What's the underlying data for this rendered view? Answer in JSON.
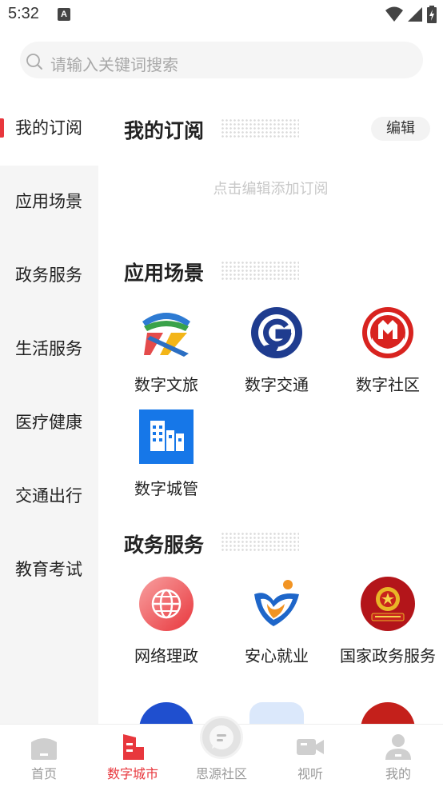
{
  "status_bar": {
    "time": "5:32",
    "notification_badge": "A"
  },
  "search": {
    "placeholder": "请输入关键词搜索"
  },
  "sidebar": {
    "items": [
      {
        "label": "我的订阅",
        "active": true
      },
      {
        "label": "应用场景"
      },
      {
        "label": "政务服务"
      },
      {
        "label": "生活服务"
      },
      {
        "label": "医疗健康"
      },
      {
        "label": "交通出行"
      },
      {
        "label": "教育考试"
      }
    ]
  },
  "subscriptions": {
    "title": "我的订阅",
    "edit_label": "编辑",
    "empty_hint": "点击编辑添加订阅"
  },
  "scenes": {
    "title": "应用场景",
    "apps": [
      {
        "name": "数字文旅",
        "icon": "culture-tourism-icon"
      },
      {
        "name": "数字交通",
        "icon": "transport-icon"
      },
      {
        "name": "数字社区",
        "icon": "community-icon"
      },
      {
        "name": "数字城管",
        "icon": "city-management-icon"
      }
    ]
  },
  "gov_services": {
    "title": "政务服务",
    "apps": [
      {
        "name": "网络理政",
        "icon": "globe-icon"
      },
      {
        "name": "安心就业",
        "icon": "employment-icon"
      },
      {
        "name": "国家政务服务",
        "icon": "national-emblem-icon"
      }
    ]
  },
  "bottom_nav": {
    "items": [
      {
        "label": "首页",
        "icon": "home-icon"
      },
      {
        "label": "数字城市",
        "icon": "city-icon",
        "active": true
      },
      {
        "label": "思源社区",
        "icon": "chat-icon"
      },
      {
        "label": "视听",
        "icon": "video-icon"
      },
      {
        "label": "我的",
        "icon": "person-icon"
      }
    ]
  },
  "colors": {
    "accent": "#e8373d",
    "sidebar_bg": "#f5f5f5"
  }
}
